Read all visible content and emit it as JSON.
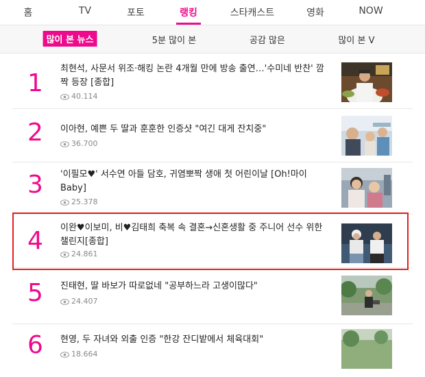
{
  "topnav": {
    "tabs": [
      {
        "label": "홈"
      },
      {
        "label": "TV"
      },
      {
        "label": "포토"
      },
      {
        "label": "랭킹"
      },
      {
        "label": "스타캐스트"
      },
      {
        "label": "영화"
      },
      {
        "label": "NOW"
      }
    ],
    "active_tab": "랭킹"
  },
  "subnav": {
    "items": [
      {
        "label": "많이 본 뉴스"
      },
      {
        "label": "5분 많이 본"
      },
      {
        "label": "공감 많은"
      },
      {
        "label": "많이 본 V"
      }
    ],
    "active_item": "많이 본 뉴스"
  },
  "articles": [
    {
      "rank": "1",
      "title": "최현석, 사문서 위조·해킹 논란 4개월 만에 방송 출연…'수미네 반찬' 깜짝 등장 [종합]",
      "views": "40.114",
      "thumb_icon": "chef-photo-icon"
    },
    {
      "rank": "2",
      "title": "이아현, 예쁜 두 딸과 훈훈한 인증샷 \"여긴 대게 잔치중\"",
      "views": "36.700",
      "thumb_icon": "family-photo-icon"
    },
    {
      "rank": "3",
      "title": "'이필모♥' 서수연 아들 담호, 귀염뽀짝 생애 첫 어린이날 [Oh!마이 Baby]",
      "views": "25.378",
      "thumb_icon": "mother-child-photo-icon"
    },
    {
      "rank": "4",
      "title": "이완♥이보미, 비♥김태희 축복 속 결혼→신혼생활 중 주니어 선수 위한 챌린지[종합]",
      "views": "24.861",
      "thumb_icon": "couple-photo-icon"
    },
    {
      "rank": "5",
      "title": "진태현, 딸 바보가 따로없네 \"공부하느라 고생이많다\"",
      "views": "24.407",
      "thumb_icon": "outdoor-photo-icon"
    },
    {
      "rank": "6",
      "title": "현영, 두 자녀와 외출 인증 \"한강 잔디밭에서 체육대회\"",
      "views": "18.664",
      "thumb_icon": "park-photo-icon"
    }
  ],
  "colors": {
    "accent": "#ee0a8c",
    "highlight_box": "#e0201c"
  }
}
